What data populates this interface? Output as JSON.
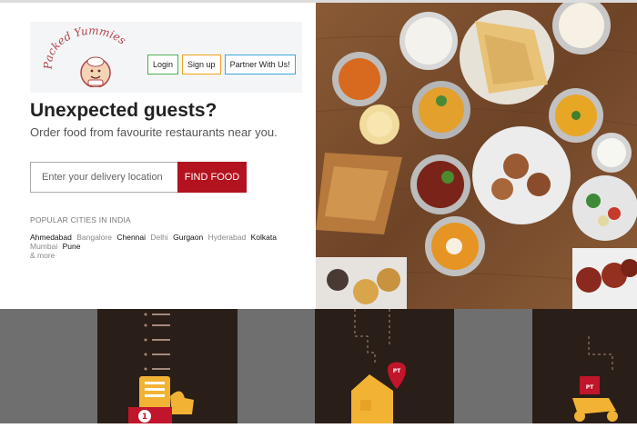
{
  "brand": {
    "name": "Packed Yummies"
  },
  "nav": {
    "login": "Login",
    "signup": "Sign up",
    "partner": "Partner With Us!"
  },
  "hero": {
    "headline": "Unexpected guests?",
    "subheadline": "Order food from favourite restaurants near you."
  },
  "search": {
    "placeholder": "Enter your delivery location",
    "button": "FIND FOOD"
  },
  "cities": {
    "title": "POPULAR CITIES IN INDIA",
    "list": [
      {
        "name": "Ahmedabad",
        "style": "strong"
      },
      {
        "name": "Bangalore",
        "style": "light"
      },
      {
        "name": "Chennai",
        "style": "strong"
      },
      {
        "name": "Delhi",
        "style": "light"
      },
      {
        "name": "Gurgaon",
        "style": "strong"
      },
      {
        "name": "Hyderabad",
        "style": "light"
      },
      {
        "name": "Kolkata",
        "style": "strong"
      },
      {
        "name": "Mumbai",
        "style": "light"
      },
      {
        "name": "Pune",
        "style": "strong"
      }
    ],
    "more": "& more"
  },
  "colors": {
    "accent": "#b3121f",
    "panel": "#2a1e18",
    "footer_gray": "#6f6f6f",
    "map_pin": "#c0152a",
    "food_box": "#f2b233"
  },
  "illustrations": {
    "badge_left": "1",
    "pin_label": "PT",
    "scooter_label": "PT"
  }
}
